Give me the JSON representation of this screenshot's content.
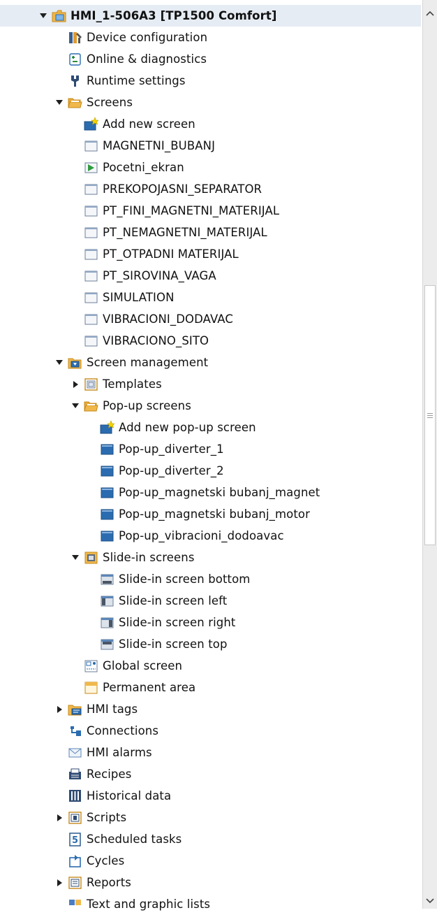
{
  "tree": [
    {
      "depth": 0,
      "toggle": "expanded",
      "icon": "device-folder-icon",
      "label": "HMI_1-506A3 [TP1500 Comfort]",
      "bold": true
    },
    {
      "depth": 1,
      "toggle": "none",
      "icon": "device-configuration-icon",
      "label": "Device configuration"
    },
    {
      "depth": 1,
      "toggle": "none",
      "icon": "online-diagnostics-icon",
      "label": "Online & diagnostics"
    },
    {
      "depth": 1,
      "toggle": "none",
      "icon": "runtime-settings-icon",
      "label": "Runtime settings"
    },
    {
      "depth": 1,
      "toggle": "expanded",
      "icon": "folder-open-icon",
      "label": "Screens"
    },
    {
      "depth": 2,
      "toggle": "none",
      "icon": "add-new-screen-icon",
      "label": "Add new screen"
    },
    {
      "depth": 2,
      "toggle": "none",
      "icon": "screen-icon",
      "label": "MAGNETNI_BUBANJ"
    },
    {
      "depth": 2,
      "toggle": "none",
      "icon": "start-screen-icon",
      "label": "Pocetni_ekran"
    },
    {
      "depth": 2,
      "toggle": "none",
      "icon": "screen-icon",
      "label": "PREKOPOJASNI_SEPARATOR"
    },
    {
      "depth": 2,
      "toggle": "none",
      "icon": "screen-icon",
      "label": "PT_FINI_MAGNETNI_MATERIJAL"
    },
    {
      "depth": 2,
      "toggle": "none",
      "icon": "screen-icon",
      "label": "PT_NEMAGNETNI_MATERIJAL"
    },
    {
      "depth": 2,
      "toggle": "none",
      "icon": "screen-icon",
      "label": "PT_OTPADNI MATERIJAL"
    },
    {
      "depth": 2,
      "toggle": "none",
      "icon": "screen-icon",
      "label": "PT_SIROVINA_VAGA"
    },
    {
      "depth": 2,
      "toggle": "none",
      "icon": "screen-icon",
      "label": "SIMULATION"
    },
    {
      "depth": 2,
      "toggle": "none",
      "icon": "screen-icon",
      "label": "VIBRACIONI_DODAVAC"
    },
    {
      "depth": 2,
      "toggle": "none",
      "icon": "screen-icon",
      "label": "VIBRACIONO_SITO"
    },
    {
      "depth": 1,
      "toggle": "expanded",
      "icon": "screen-management-icon",
      "label": "Screen management"
    },
    {
      "depth": 2,
      "toggle": "collapsed",
      "icon": "templates-folder-icon",
      "label": "Templates"
    },
    {
      "depth": 2,
      "toggle": "expanded",
      "icon": "folder-open-icon",
      "label": "Pop-up screens"
    },
    {
      "depth": 3,
      "toggle": "none",
      "icon": "add-new-screen-icon",
      "label": "Add new pop-up screen"
    },
    {
      "depth": 3,
      "toggle": "none",
      "icon": "popup-screen-icon",
      "label": "Pop-up_diverter_1"
    },
    {
      "depth": 3,
      "toggle": "none",
      "icon": "popup-screen-icon",
      "label": "Pop-up_diverter_2"
    },
    {
      "depth": 3,
      "toggle": "none",
      "icon": "popup-screen-icon",
      "label": "Pop-up_magnetski bubanj_magnet"
    },
    {
      "depth": 3,
      "toggle": "none",
      "icon": "popup-screen-icon",
      "label": "Pop-up_magnetski bubanj_motor"
    },
    {
      "depth": 3,
      "toggle": "none",
      "icon": "popup-screen-icon",
      "label": "Pop-up_vibracioni_dodoavac"
    },
    {
      "depth": 2,
      "toggle": "expanded",
      "icon": "slidein-folder-icon",
      "label": "Slide-in screens"
    },
    {
      "depth": 3,
      "toggle": "none",
      "icon": "slidein-bottom-icon",
      "label": "Slide-in screen bottom"
    },
    {
      "depth": 3,
      "toggle": "none",
      "icon": "slidein-left-icon",
      "label": "Slide-in screen left"
    },
    {
      "depth": 3,
      "toggle": "none",
      "icon": "slidein-right-icon",
      "label": "Slide-in screen right"
    },
    {
      "depth": 3,
      "toggle": "none",
      "icon": "slidein-top-icon",
      "label": "Slide-in screen top"
    },
    {
      "depth": 2,
      "toggle": "none",
      "icon": "global-screen-icon",
      "label": "Global screen"
    },
    {
      "depth": 2,
      "toggle": "none",
      "icon": "permanent-area-icon",
      "label": "Permanent area"
    },
    {
      "depth": 1,
      "toggle": "collapsed",
      "icon": "hmi-tags-icon",
      "label": "HMI tags"
    },
    {
      "depth": 1,
      "toggle": "none",
      "icon": "connections-icon",
      "label": "Connections"
    },
    {
      "depth": 1,
      "toggle": "none",
      "icon": "hmi-alarms-icon",
      "label": "HMI alarms"
    },
    {
      "depth": 1,
      "toggle": "none",
      "icon": "recipes-icon",
      "label": "Recipes"
    },
    {
      "depth": 1,
      "toggle": "none",
      "icon": "historical-data-icon",
      "label": "Historical data"
    },
    {
      "depth": 1,
      "toggle": "collapsed",
      "icon": "scripts-icon",
      "label": "Scripts"
    },
    {
      "depth": 1,
      "toggle": "none",
      "icon": "scheduled-tasks-icon",
      "label": "Scheduled tasks"
    },
    {
      "depth": 1,
      "toggle": "none",
      "icon": "cycles-icon",
      "label": "Cycles"
    },
    {
      "depth": 1,
      "toggle": "collapsed",
      "icon": "reports-icon",
      "label": "Reports"
    },
    {
      "depth": 1,
      "toggle": "none",
      "icon": "text-graphic-lists-icon",
      "label": "Text and graphic lists"
    }
  ],
  "colors": {
    "selection": "#e6ecf3",
    "folder": "#f0b84a",
    "screen": "#2b6cb0",
    "text": "#111111"
  },
  "scrollbar": {
    "icons": [
      "scroll-up-icon",
      "scroll-down-icon",
      "grip-icon"
    ]
  }
}
